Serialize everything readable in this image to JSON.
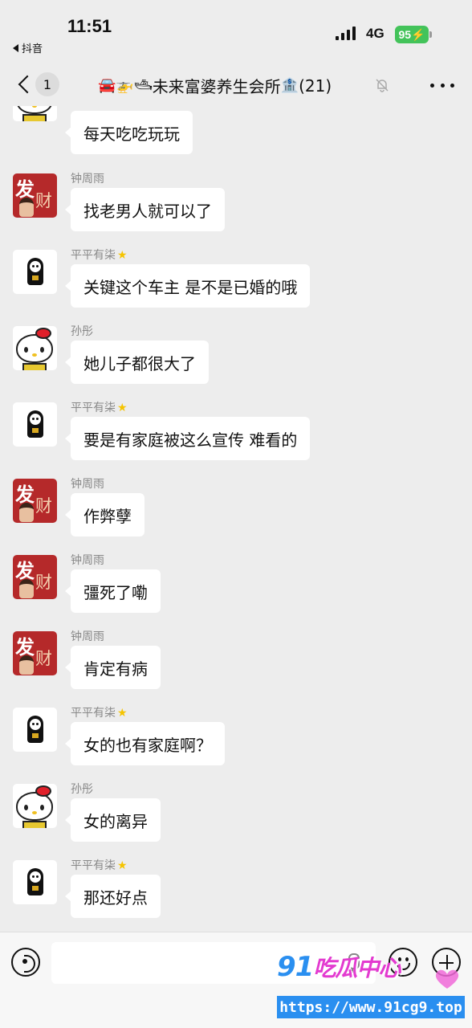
{
  "status_bar": {
    "time": "11:51",
    "back_app": "抖音",
    "network": "4G",
    "battery": "95"
  },
  "nav": {
    "unread_count": "1",
    "title_emoji": "🚘🚁🛥",
    "title_text": "未来富婆养生会所",
    "title_bank": "🏦",
    "member_count": "(21)"
  },
  "messages": [
    {
      "sender": "",
      "text": "每天吃吃玩玩",
      "avatar": "kitty"
    },
    {
      "sender": "钟周雨",
      "text": "找老男人就可以了",
      "avatar": "fa"
    },
    {
      "sender": "平平有柒",
      "text": "关键这个车主 是不是已婚的哦",
      "avatar": "ghost"
    },
    {
      "sender": "孙彤",
      "text": "她儿子都很大了",
      "avatar": "kitty"
    },
    {
      "sender": "平平有柒",
      "text": "要是有家庭被这么宣传 难看的",
      "avatar": "ghost"
    },
    {
      "sender": "钟周雨",
      "text": "作弊孽",
      "avatar": "fa"
    },
    {
      "sender": "钟周雨",
      "text": "彊死了嘞",
      "avatar": "fa"
    },
    {
      "sender": "钟周雨",
      "text": "肯定有病",
      "avatar": "fa"
    },
    {
      "sender": "平平有柒",
      "text": "女的也有家庭啊？",
      "avatar": "ghost"
    },
    {
      "sender": "孙彤",
      "text": "女的离异",
      "avatar": "kitty"
    },
    {
      "sender": "平平有柒",
      "text": "那还好点",
      "avatar": "ghost"
    }
  ],
  "avatar_text": {
    "fa_1": "发",
    "fa_2": "财"
  },
  "watermark": {
    "logo_num": "91",
    "logo_cn": "吃瓜中心",
    "url": "https://www.91cg9.top"
  },
  "colors": {
    "background": "#ededed",
    "bubble": "#ffffff",
    "battery": "#43c35a",
    "watermark_blue": "#2a8ff0"
  }
}
